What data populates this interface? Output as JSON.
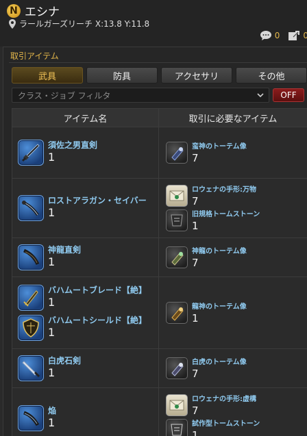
{
  "npc": {
    "name": "エシナ",
    "location": "ラールガーズリーチ X:13.8 Y:11.8"
  },
  "counters": {
    "comments": "0",
    "shares": "0"
  },
  "section_title": "取引アイテム",
  "tabs": [
    {
      "label": "武具",
      "active": true
    },
    {
      "label": "防具",
      "active": false
    },
    {
      "label": "アクセサリ",
      "active": false
    },
    {
      "label": "その他",
      "active": false
    }
  ],
  "filter": {
    "placeholder": "クラス・ジョブ フィルタ",
    "toggle_label": "OFF"
  },
  "table": {
    "headers": [
      "アイテム名",
      "取引に必要なアイテム"
    ],
    "rows": [
      {
        "items": [
          {
            "name": "須佐之男直剣",
            "qty": "1",
            "icon": "sword-icon"
          }
        ],
        "costs": [
          {
            "name": "蛮神のトーテム像",
            "qty": "7",
            "icon": "totem-icon"
          }
        ]
      },
      {
        "items": [
          {
            "name": "ロストアラガン・セイバー",
            "qty": "1",
            "icon": "saber-icon"
          }
        ],
        "costs": [
          {
            "name": "ロウェナの手形:万物",
            "qty": "7",
            "icon": "letter-icon"
          },
          {
            "name": "旧規格トームストーン",
            "qty": "1",
            "icon": "tomestone-icon"
          }
        ]
      },
      {
        "items": [
          {
            "name": "神龍直剣",
            "qty": "1",
            "icon": "sword-icon"
          }
        ],
        "costs": [
          {
            "name": "神龍のトーテム像",
            "qty": "7",
            "icon": "totem-icon"
          }
        ]
      },
      {
        "items": [
          {
            "name": "バハムートブレード【絶】",
            "qty": "1",
            "icon": "blade-icon"
          },
          {
            "name": "バハムートシールド【絶】",
            "qty": "1",
            "icon": "shield-icon"
          }
        ],
        "costs": [
          {
            "name": "龍神のトーテム像",
            "qty": "1",
            "icon": "totem-icon"
          }
        ]
      },
      {
        "items": [
          {
            "name": "白虎石剣",
            "qty": "1",
            "icon": "sword-icon"
          }
        ],
        "costs": [
          {
            "name": "白虎のトーテム像",
            "qty": "7",
            "icon": "totem-icon"
          }
        ]
      },
      {
        "items": [
          {
            "name": "焔",
            "qty": "1",
            "icon": "sword-icon"
          }
        ],
        "costs": [
          {
            "name": "ロウェナの手形:虚構",
            "qty": "7",
            "icon": "letter-icon"
          },
          {
            "name": "試作型トームストーン",
            "qty": "1",
            "icon": "tomestone-icon"
          }
        ]
      }
    ]
  },
  "colors": {
    "accent": "#e3b64a",
    "link": "#8fc9ee",
    "off_button": "#8a1c1c"
  }
}
